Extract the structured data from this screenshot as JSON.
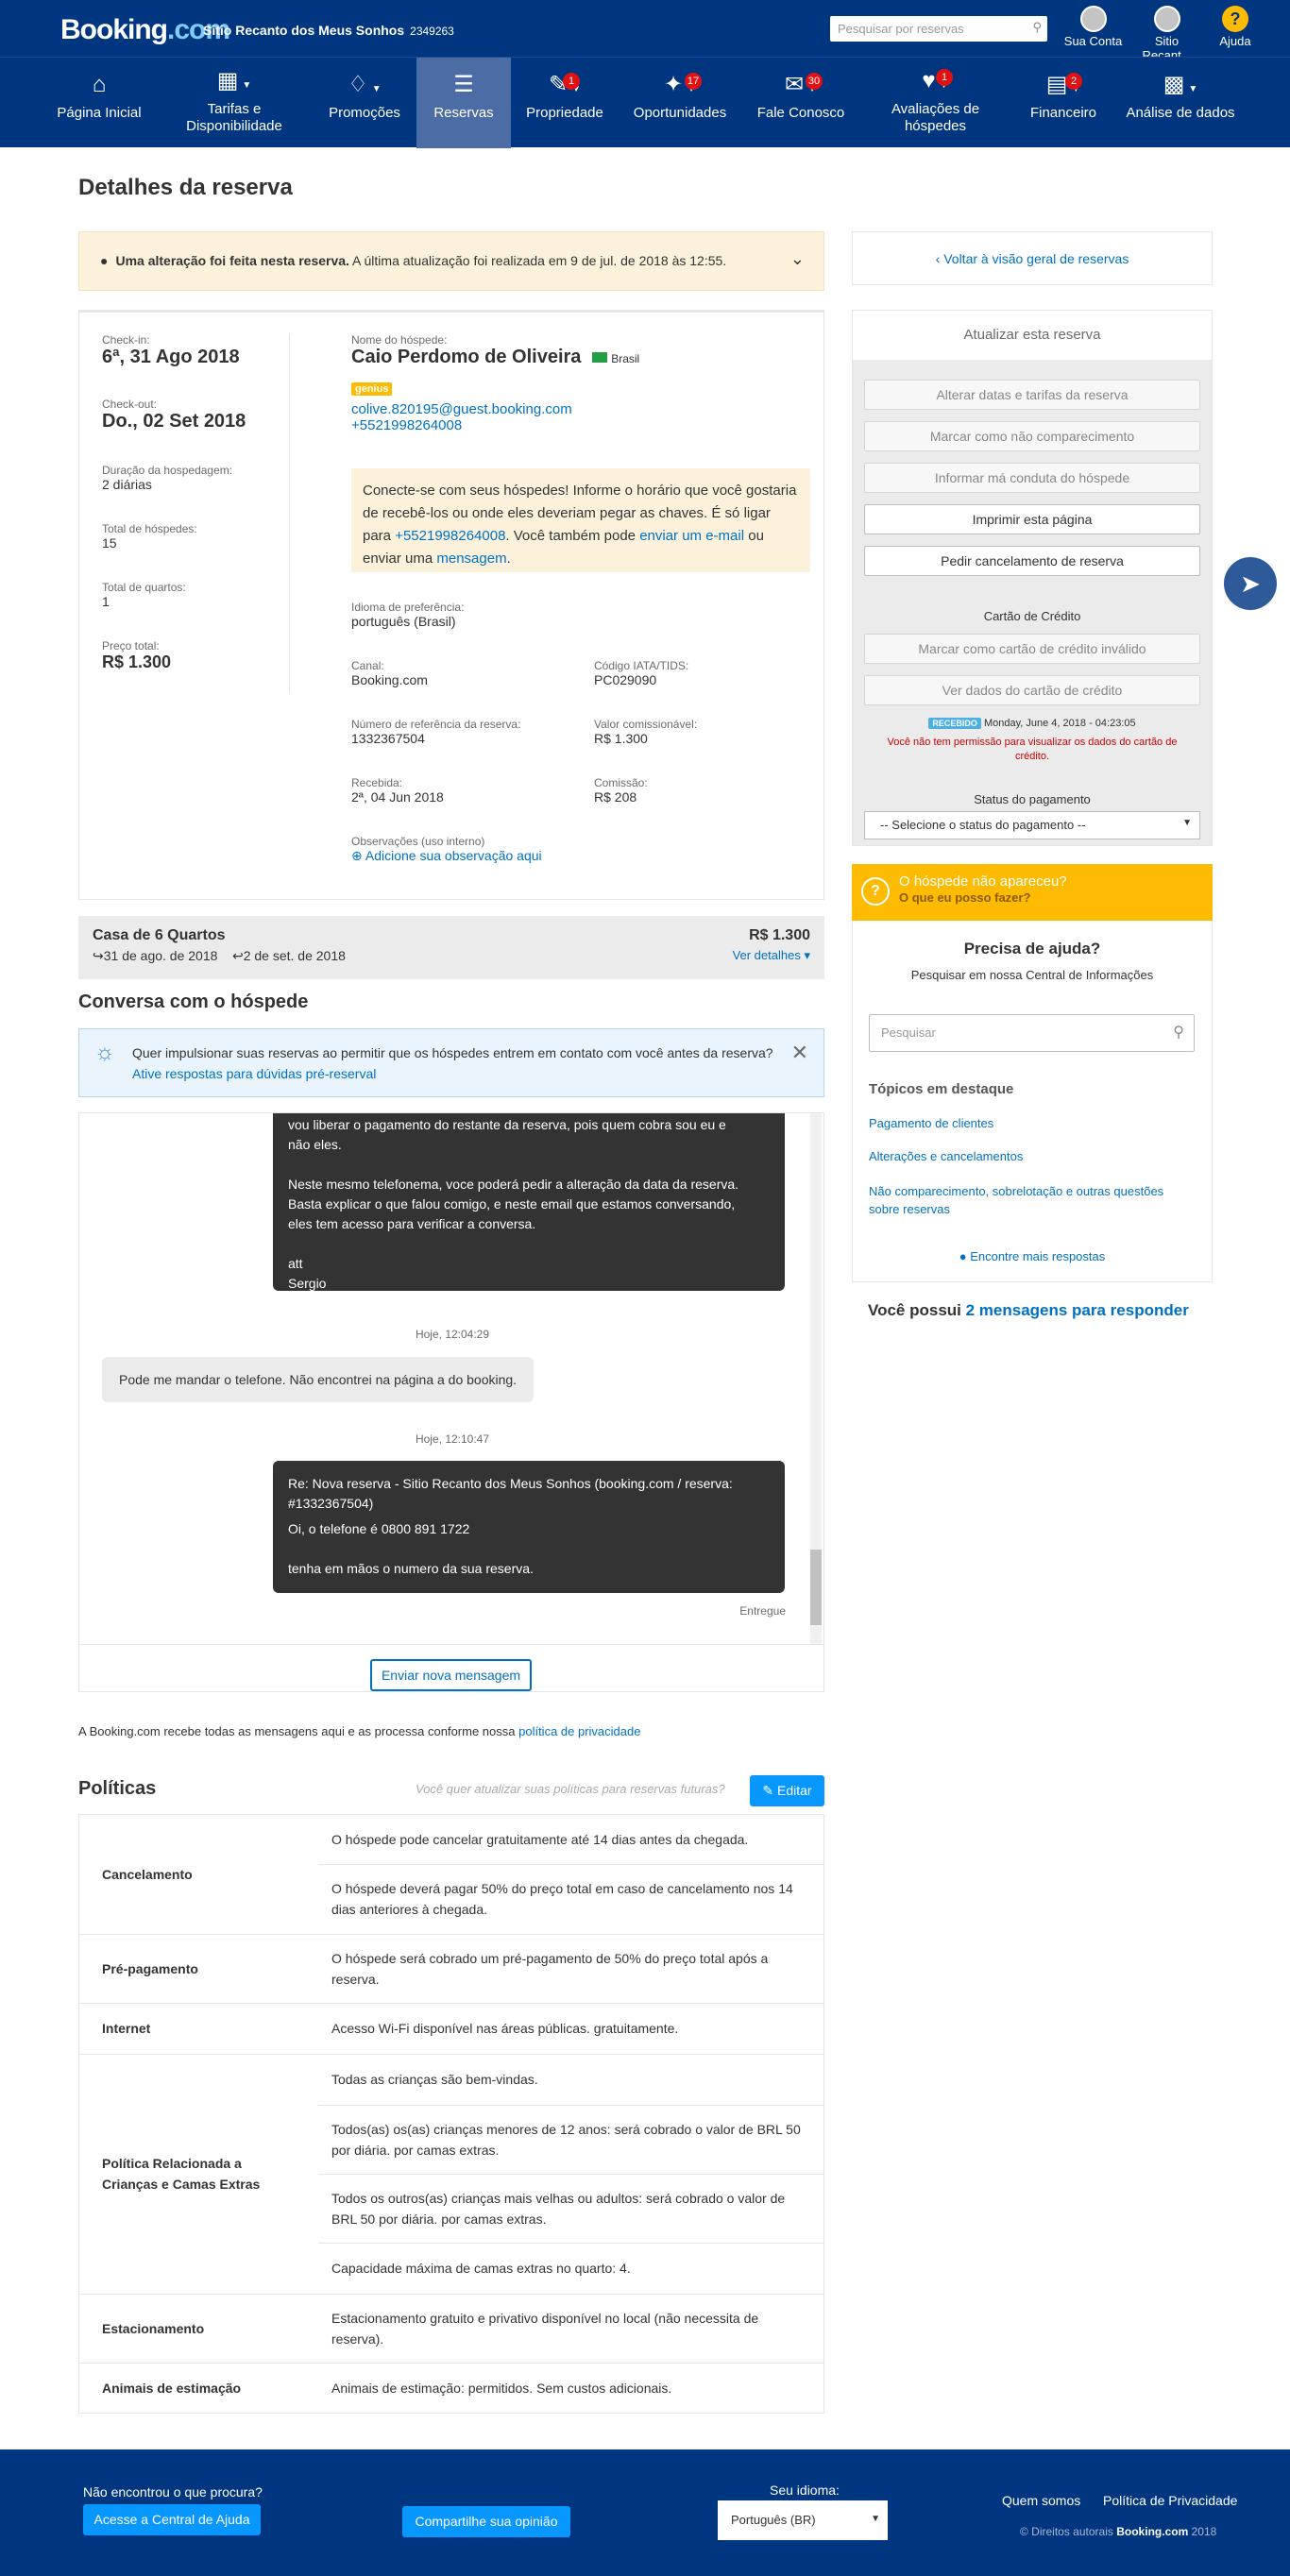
{
  "header": {
    "logo_text": "Booking",
    "logo_suffix": ".com",
    "hotel_name": "Sitio Recanto dos Meus Sonhos",
    "hotel_id": "2349263",
    "search_placeholder": "Pesquisar por reservas",
    "account_label": "Sua Conta",
    "property_label": "Sitio Recant...",
    "help_label": "Ajuda",
    "help_glyph": "?"
  },
  "nav": {
    "items": [
      {
        "label": "Página Inicial",
        "icon": "home-icon"
      },
      {
        "label": "Tarifas e Disponibilidade",
        "icon": "calendar-icon"
      },
      {
        "label": "Promoções",
        "icon": "tag-icon"
      },
      {
        "label": "Reservas",
        "icon": "list-icon"
      },
      {
        "label": "Propriedade",
        "icon": "pen-icon",
        "badge": "1"
      },
      {
        "label": "Oportunidades",
        "icon": "rocket-icon",
        "badge": "17"
      },
      {
        "label": "Fale Conosco",
        "icon": "mail-icon",
        "badge": "30"
      },
      {
        "label": "Avaliações de hóspedes",
        "icon": "heart-icon",
        "badge": "1"
      },
      {
        "label": "Financeiro",
        "icon": "document-icon",
        "badge": "2"
      },
      {
        "label": "Análise de dados",
        "icon": "chart-icon"
      }
    ]
  },
  "page": {
    "title": "Detalhes da reserva",
    "alert_bold": "Uma alteração foi feita nesta reserva.",
    "alert_text": " A última atualização foi realizada em 9 de jul. de 2018 às 12:55."
  },
  "details": {
    "checkin_label": "Check-in:",
    "checkin_value": "6ª, 31 Ago 2018",
    "checkout_label": "Check-out:",
    "checkout_value": "Do., 02 Set 2018",
    "duration_label": "Duração da hospedagem:",
    "duration_value": "2 diárias",
    "guests_label": "Total de hóspedes:",
    "guests_value": "15",
    "rooms_label": "Total de quartos:",
    "rooms_value": "1",
    "price_label": "Preço total:",
    "price_value": "R$ 1.300",
    "guest_name_label": "Nome do hóspede:",
    "guest_name": "Caio Perdomo de Oliveira",
    "guest_country": "Brasil",
    "genius": "genius",
    "email": "colive.820195@guest.booking.com",
    "phone": "+5521998264008",
    "contact_p1": "Conecte-se com seus hóspedes! Informe o horário que você gostaria de recebê-los ou onde eles deveriam pegar as chaves. É só ligar para ",
    "contact_phone": "+5521998264008",
    "contact_p2": ". Você também pode ",
    "contact_email_link": "enviar um e-mail",
    "contact_p3": " ou enviar uma ",
    "contact_msg_link": "mensagem",
    "contact_p4": ".",
    "lang_label": "Idioma de preferência:",
    "lang_value": "português (Brasil)",
    "channel_label": "Canal:",
    "channel_value": "Booking.com",
    "iata_label": "Código IATA/TIDS:",
    "iata_value": "PC029090",
    "ref_label": "Número de referência da reserva:",
    "ref_value": "1332367504",
    "comm_value_label": "Valor comissionável:",
    "comm_value": "R$ 1.300",
    "received_label": "Recebida:",
    "received_value": "2ª, 04 Jun 2018",
    "commission_label": "Comissão:",
    "commission_value": "R$ 208",
    "notes_label": "Observações (uso interno)",
    "notes_link": "Adicione sua observação aqui"
  },
  "room": {
    "title": "Casa de 6 Quartos",
    "price": "R$ 1.300",
    "checkin": "31 de ago. de 2018",
    "checkout": "2 de set. de 2018",
    "details_link": "Ver detalhes"
  },
  "chat": {
    "heading": "Conversa com o hóspede",
    "tip_text": "Quer impulsionar suas reservas ao permitir que os hóspedes entrem em contato com você antes da reserva?",
    "tip_link": "Ative respostas para dúvidas pré-reserval",
    "msg1_l1": "vou liberar o pagamento do restante da reserva, pois quem cobra sou eu e",
    "msg1_l2": "não eles.",
    "msg1_l3": "Neste mesmo telefonema, voce poderá pedir a alteração da data da reserva.",
    "msg1_l4": "Basta explicar o que falou comigo, e neste email que estamos conversando,",
    "msg1_l5": "eles tem acesso para verificar a conversa.",
    "msg1_l6": "att",
    "msg1_l7": "Sergio",
    "ts1": "Hoje, 12:04:29",
    "msg2": "Pode me mandar o telefone. Não encontrei na página a do booking.",
    "ts2": "Hoje, 12:10:47",
    "msg3_l1": "Re: Nova reserva - Sitio Recanto dos Meus Sonhos (booking.com / reserva:",
    "msg3_l2": "#1332367504)",
    "msg3_l3": "Oi, o telefone é 0800 891 1722",
    "msg3_l4": "tenha em mãos o numero da sua reserva.",
    "delivered": "Entregue",
    "send_button": "Enviar nova mensagem",
    "privacy_text": "A Booking.com recebe todas as mensagens aqui e as processa conforme nossa ",
    "privacy_link": "política de privacidade"
  },
  "policies": {
    "heading": "Políticas",
    "question": "Você quer atualizar suas políticas para reservas futuras?",
    "edit_button": "Editar",
    "cancel_key": "Cancelamento",
    "cancel_v1": "O hóspede pode cancelar gratuitamente até 14 dias antes da chegada.",
    "cancel_v2": "O hóspede deverá pagar 50% do preço total em caso de cancelamento nos 14 dias anteriores à chegada.",
    "prepay_key": "Pré-pagamento",
    "prepay_v": "O hóspede será cobrado um pré-pagamento de 50% do preço total após a reserva.",
    "internet_key": "Internet",
    "internet_v": "Acesso Wi-Fi disponível nas áreas públicas. gratuitamente.",
    "kids_key": "Política Relacionada a Crianças e Camas Extras",
    "kids_v1": "Todas as crianças são bem-vindas.",
    "kids_v2": "Todos(as) os(as) crianças menores de 12 anos: será cobrado o valor de BRL 50 por diária. por camas extras.",
    "kids_v3": "Todos os outros(as) crianças mais velhas ou adultos: será cobrado o valor de BRL 50 por diária. por camas extras.",
    "kids_v4": "Capacidade máxima de camas extras no quarto: 4.",
    "parking_key": "Estacionamento",
    "parking_v": "Estacionamento gratuito e privativo disponível no local (não necessita de reserva).",
    "pets_key": "Animais de estimação",
    "pets_v": "Animais de estimação: permitidos. Sem custos adicionais."
  },
  "sidebar": {
    "back_link": "Voltar à visão geral de reservas",
    "update_title": "Atualizar esta reserva",
    "btn_dates": "Alterar datas e tarifas da reserva",
    "btn_noshow": "Marcar como não comparecimento",
    "btn_misconduct": "Informar má conduta do hóspede",
    "btn_print": "Imprimir esta página",
    "btn_cancel": "Pedir cancelamento de reserva",
    "cc_title": "Cartão de Crédito",
    "btn_invalid": "Marcar como cartão de crédito inválido",
    "btn_viewcc": "Ver dados do cartão de crédito",
    "received_badge": "RECEBIDO",
    "received_date": "Monday, June 4, 2018 - 04:23:05",
    "no_permission": "Você não tem permissão para visualizar os dados do cartão de crédito.",
    "pay_status_label": "Status do pagamento",
    "pay_status_select": "-- Selecione o status do pagamento --",
    "noshow_q": "O hóspede não apareceu?",
    "noshow_link": "O que eu posso fazer?",
    "help_title": "Precisa de ajuda?",
    "help_sub": "Pesquisar em nossa Central de Informações",
    "help_search_placeholder": "Pesquisar",
    "topics_title": "Tópicos em destaque",
    "topic1": "Pagamento de clientes",
    "topic2": "Alterações e cancelamentos",
    "topic3": "Não comparecimento, sobrelotação e outras questões sobre reservas",
    "more_answers": "Encontre mais respostas",
    "messages_text": "Você possui ",
    "messages_link": "2 mensagens para responder"
  },
  "footer": {
    "not_found": "Não encontrou o que procura?",
    "help_button": "Acesse a Central de Ajuda",
    "share_button": "Compartilhe sua opinião",
    "lang_label": "Seu idioma:",
    "lang_value": "Português (BR)",
    "about": "Quem somos",
    "privacy": "Política de Privacidade",
    "copyright": "© Direitos autorais",
    "copyright_brand": "Booking.com",
    "copyright_year": "2018"
  },
  "colors": {
    "brand_navy": "#003580",
    "nav_active": "#4b6ca4",
    "link_blue": "#0071c2",
    "genius_yellow": "#febb02",
    "badge_red": "#e21111"
  }
}
